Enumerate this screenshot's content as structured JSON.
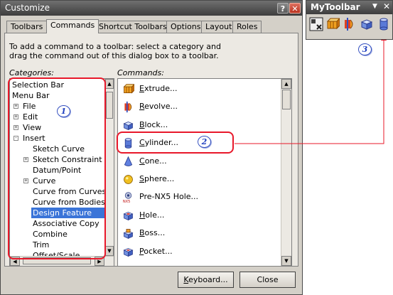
{
  "dialog": {
    "title": "Customize",
    "help_glyph": "?",
    "close_glyph": "✕",
    "tabs": [
      "Toolbars",
      "Commands",
      "Shortcut Toolbars",
      "Options",
      "Layout",
      "Roles"
    ],
    "active_tab": "Commands",
    "instruction": "To add a command to a toolbar: select a category and drag the command out of this dialog box to a toolbar.",
    "categories_label": "Categories:",
    "commands_label": "Commands:",
    "categories": [
      {
        "label": "Selection Bar",
        "indent": 0,
        "expander": ""
      },
      {
        "label": "Menu Bar",
        "indent": 0,
        "expander": ""
      },
      {
        "label": "File",
        "indent": 1,
        "expander": "+"
      },
      {
        "label": "Edit",
        "indent": 1,
        "expander": "+"
      },
      {
        "label": "View",
        "indent": 1,
        "expander": "+"
      },
      {
        "label": "Insert",
        "indent": 1,
        "expander": "-"
      },
      {
        "label": "Sketch Curve",
        "indent": 2,
        "expander": ""
      },
      {
        "label": "Sketch Constraint",
        "indent": 2,
        "expander": "+"
      },
      {
        "label": "Datum/Point",
        "indent": 2,
        "expander": ""
      },
      {
        "label": "Curve",
        "indent": 2,
        "expander": "+"
      },
      {
        "label": "Curve from Curves",
        "indent": 2,
        "expander": ""
      },
      {
        "label": "Curve from Bodies",
        "indent": 2,
        "expander": ""
      },
      {
        "label": "Design Feature",
        "indent": 2,
        "expander": "",
        "selected": true
      },
      {
        "label": "Associative Copy",
        "indent": 2,
        "expander": ""
      },
      {
        "label": "Combine",
        "indent": 2,
        "expander": ""
      },
      {
        "label": "Trim",
        "indent": 2,
        "expander": ""
      },
      {
        "label": "Offset/Scale",
        "indent": 2,
        "expander": ""
      }
    ],
    "commands": [
      {
        "accel": "E",
        "rest": "xtrude...",
        "icon": "extrude-icon"
      },
      {
        "accel": "R",
        "rest": "evolve...",
        "icon": "revolve-icon"
      },
      {
        "accel": "B",
        "rest": "lock...",
        "icon": "block-icon"
      },
      {
        "accel": "C",
        "rest": "ylinder...",
        "icon": "cylinder-icon"
      },
      {
        "accel": "C",
        "rest": "one...",
        "icon": "cone-icon"
      },
      {
        "accel": "S",
        "rest": "phere...",
        "icon": "sphere-icon"
      },
      {
        "accel": "P",
        "rest": "re-NX5 Hole...",
        "icon": "pre-nx5-hole-icon",
        "accel_plain": true
      },
      {
        "accel": "H",
        "rest": "ole...",
        "icon": "hole-icon"
      },
      {
        "accel": "B",
        "rest": "oss...",
        "icon": "boss-icon"
      },
      {
        "accel": "P",
        "rest": "ocket...",
        "icon": "pocket-icon"
      },
      {
        "accel": "",
        "rest": "",
        "icon": "partial-icon"
      }
    ],
    "keyboard_button": {
      "accel": "K",
      "rest": "eyboard..."
    },
    "close_button": "Close"
  },
  "annotations": [
    "1",
    "2",
    "3"
  ],
  "my_toolbar": {
    "title": "MyToolbar",
    "dropdown_glyph": "▼",
    "close_glyph": "✕",
    "icons": [
      "toolbar-config-icon",
      "extrude-icon",
      "revolve-icon",
      "block-icon",
      "cylinder-icon"
    ]
  },
  "colors": {
    "selection": "#3a74d8",
    "annotation_red": "#e8182a",
    "annotation_blue": "#2040c0"
  }
}
